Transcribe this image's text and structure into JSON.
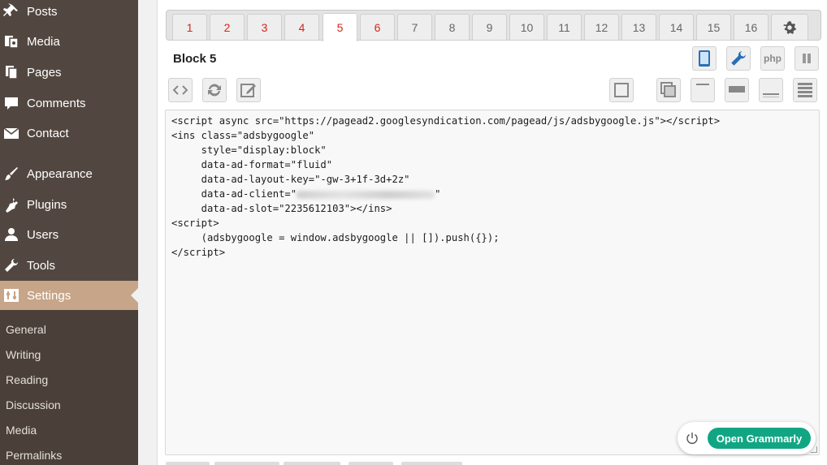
{
  "sidebar": {
    "items": [
      {
        "label": "Posts",
        "icon": "pin-icon"
      },
      {
        "label": "Media",
        "icon": "media-icon"
      },
      {
        "label": "Pages",
        "icon": "pages-icon"
      },
      {
        "label": "Comments",
        "icon": "comment-icon"
      },
      {
        "label": "Contact",
        "icon": "mail-icon"
      },
      {
        "label": "Appearance",
        "icon": "brush-icon"
      },
      {
        "label": "Plugins",
        "icon": "plug-icon"
      },
      {
        "label": "Users",
        "icon": "user-icon"
      },
      {
        "label": "Tools",
        "icon": "wrench-icon"
      },
      {
        "label": "Settings",
        "icon": "settings-icon",
        "active": true
      }
    ],
    "submenu": [
      "General",
      "Writing",
      "Reading",
      "Discussion",
      "Media",
      "Permalinks"
    ]
  },
  "tabs": [
    "1",
    "2",
    "3",
    "4",
    "5",
    "6",
    "7",
    "8",
    "9",
    "10",
    "11",
    "12",
    "13",
    "14",
    "15",
    "16"
  ],
  "active_tab": "5",
  "block": {
    "title": "Block 5"
  },
  "code_lines": [
    "<script async src=\"https://pagead2.googlesyndication.com/pagead/js/adsbygoogle.js\"></scr",
    "<ins class=\"adsbygoogle\"",
    "     style=\"display:block\"",
    "     data-ad-format=\"fluid\"",
    "     data-ad-layout-key=\"-gw-3+1f-3d+2z\"",
    "     data-ad-client=\"",
    "     data-ad-slot=\"2235612103\"></ins>",
    "<script>",
    "     (adsbygoogle = window.adsbygoogle || []).push({});",
    "</scr"
  ],
  "code_tail": "ipt>",
  "grammarly": {
    "label": "Open Grammarly"
  },
  "colors": {
    "sidebar": "#524740",
    "active": "#c7a589",
    "tab_red": "#d9241a",
    "grammarly": "#11a683"
  }
}
